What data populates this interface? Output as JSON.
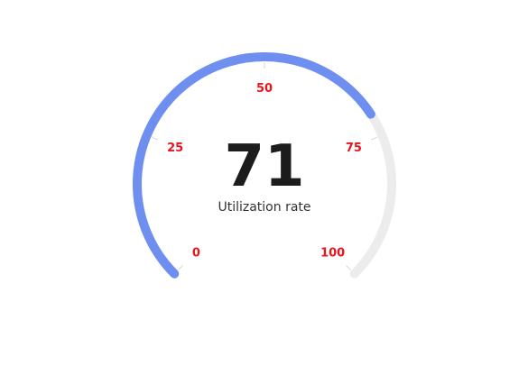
{
  "chart_data": {
    "type": "gauge",
    "value": 71,
    "min": 0,
    "max": 100,
    "label": "Utilization rate",
    "ticks": [
      {
        "value": 0,
        "label": "0"
      },
      {
        "value": 25,
        "label": "25"
      },
      {
        "value": 50,
        "label": "50"
      },
      {
        "value": 75,
        "label": "75"
      },
      {
        "value": 100,
        "label": "100"
      }
    ],
    "colors": {
      "progress": "#6f8ff0",
      "track": "#ececec",
      "tick_label": "#e8141d",
      "value": "#1c1c1c",
      "caption": "#333333",
      "tick_mark": "#d6d6d6"
    }
  }
}
